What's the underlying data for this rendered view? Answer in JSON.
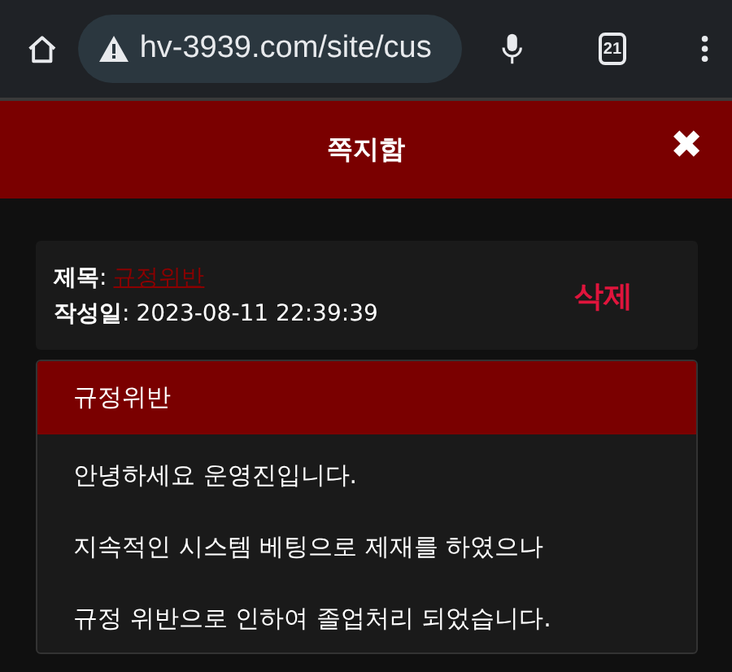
{
  "browser": {
    "url": "hv-3939.com/site/cus",
    "tab_count": "21"
  },
  "header": {
    "title": "쪽지함",
    "close": "✖"
  },
  "message": {
    "subject_label": "**제목**:",
    "subject": "규정위반",
    "date_label": "**작성일**:",
    "date": "2023-08-11 22:39:39",
    "delete": "삭제"
  },
  "body": {
    "title": "규정위반",
    "lines": [
      "안녕하세요 운영진입니다.",
      "지속적인 시스템 베팅으로 제재를 하였으나",
      "규정 위반으로 인하여 졸업처리 되었습니다."
    ]
  }
}
